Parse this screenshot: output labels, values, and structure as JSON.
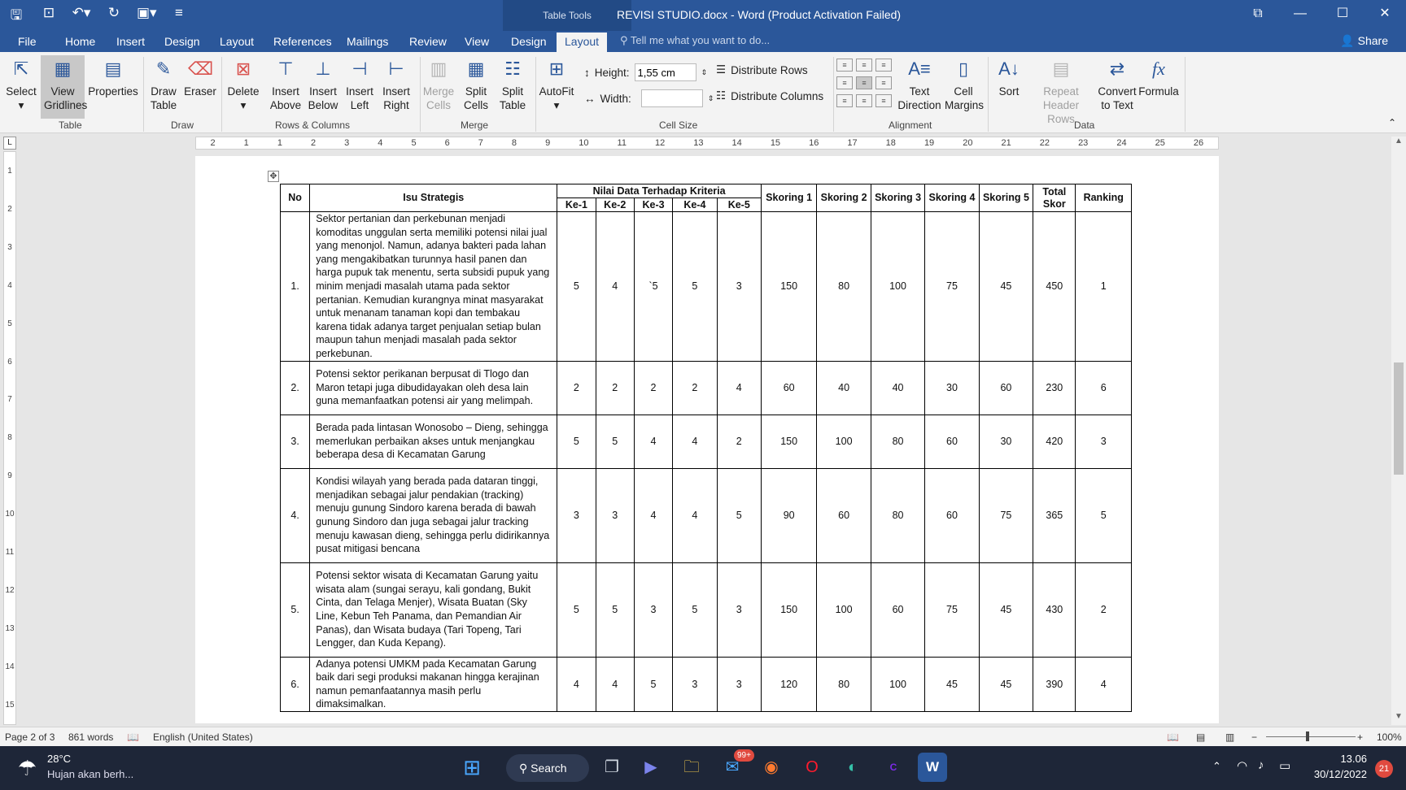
{
  "window": {
    "title": "REVISI STUDIO.docx - Word (Product Activation Failed)",
    "table_tools_label": "Table Tools",
    "controls": [
      "⧉",
      "—",
      "☐",
      "✕"
    ]
  },
  "tabs": {
    "file": "File",
    "home": "Home",
    "insert": "Insert",
    "design": "Design",
    "layout": "Layout",
    "references": "References",
    "mailings": "Mailings",
    "review": "Review",
    "view": "View",
    "table_design": "Design",
    "table_layout": "Layout",
    "tell_me": "Tell me what you want to do...",
    "share": "Share"
  },
  "ribbon": {
    "select": "Select",
    "view_gridlines": "View Gridlines",
    "properties": "Properties",
    "draw_table": "Draw Table",
    "eraser": "Eraser",
    "delete": "Delete",
    "insert_above": "Insert Above",
    "insert_below": "Insert Below",
    "insert_left": "Insert Left",
    "insert_right": "Insert Right",
    "merge_cells": "Merge Cells",
    "split_cells": "Split Cells",
    "split_table": "Split Table",
    "autofit": "AutoFit",
    "height_label": "Height:",
    "height_value": "1,55 cm",
    "width_label": "Width:",
    "width_value": "",
    "distribute_rows": "Distribute Rows",
    "distribute_columns": "Distribute Columns",
    "text_direction": "Text Direction",
    "cell_margins": "Cell Margins",
    "sort": "Sort",
    "repeat_header_rows": "Repeat Header Rows",
    "convert_to_text": "Convert to Text",
    "formula": "Formula",
    "groups": {
      "table": "Table",
      "draw": "Draw",
      "rows_columns": "Rows & Columns",
      "merge": "Merge",
      "cell_size": "Cell Size",
      "alignment": "Alignment",
      "data": "Data"
    }
  },
  "ruler": {
    "horizontal": [
      "2",
      "1",
      "1",
      "2",
      "3",
      "4",
      "5",
      "6",
      "7",
      "8",
      "9",
      "10",
      "11",
      "12",
      "13",
      "14",
      "15",
      "16",
      "17",
      "18",
      "19",
      "20",
      "21",
      "22",
      "23",
      "24",
      "25",
      "26"
    ],
    "vertical": [
      "1",
      "2",
      "3",
      "4",
      "5",
      "6",
      "7",
      "8",
      "9",
      "10",
      "11",
      "12",
      "13",
      "14",
      "15"
    ]
  },
  "table": {
    "headers": {
      "no": "No",
      "isu": "Isu Strategis",
      "nilai": "Nilai Data Terhadap Kriteria",
      "ke": [
        "Ke-1",
        "Ke-2",
        "Ke-3",
        "Ke-4",
        "Ke-5"
      ],
      "skoring": [
        "Skoring 1",
        "Skoring 2",
        "Skoring 3",
        "Skoring 4",
        "Skoring 5"
      ],
      "total": "Total Skor",
      "ranking": "Ranking"
    },
    "rows": [
      {
        "no": "1.",
        "isu": "Sektor pertanian dan perkebunan menjadi komoditas unggulan serta memiliki potensi nilai jual yang menonjol. Namun, adanya bakteri pada lahan yang mengakibatkan turunnya hasil panen dan harga pupuk tak menentu, serta subsidi pupuk yang minim menjadi masalah utama pada sektor pertanian. Kemudian kurangnya minat masyarakat untuk menanam tanaman kopi dan tembakau karena tidak adanya target penjualan setiap bulan maupun tahun menjadi masalah pada sektor perkebunan.",
        "ke1": "5",
        "ke2": "4",
        "ke3": "`5",
        "ke4": "5",
        "ke5": "3",
        "s1": "150",
        "s2": "80",
        "s3": "100",
        "s4": "75",
        "s5": "45",
        "total": "450",
        "rank": "1"
      },
      {
        "no": "2.",
        "isu": "Potensi sektor perikanan berpusat di Tlogo dan Maron tetapi juga dibudidayakan oleh desa lain guna memanfaatkan potensi air yang melimpah.",
        "ke1": "2",
        "ke2": "2",
        "ke3": "2",
        "ke4": "2",
        "ke5": "4",
        "s1": "60",
        "s2": "40",
        "s3": "40",
        "s4": "30",
        "s5": "60",
        "total": "230",
        "rank": "6"
      },
      {
        "no": "3.",
        "isu": "Berada pada lintasan Wonosobo – Dieng, sehingga memerlukan perbaikan akses untuk menjangkau beberapa desa di Kecamatan Garung",
        "ke1": "5",
        "ke2": "5",
        "ke3": "4",
        "ke4": "4",
        "ke5": "2",
        "s1": "150",
        "s2": "100",
        "s3": "80",
        "s4": "60",
        "s5": "30",
        "total": "420",
        "rank": "3"
      },
      {
        "no": "4.",
        "isu": "Kondisi wilayah yang berada pada dataran tinggi, menjadikan sebagai jalur pendakian (tracking) menuju gunung Sindoro karena berada di bawah gunung Sindoro dan juga sebagai jalur tracking menuju kawasan dieng, sehingga perlu didirikannya pusat mitigasi bencana",
        "ke1": "3",
        "ke2": "3",
        "ke3": "4",
        "ke4": "4",
        "ke5": "5",
        "s1": "90",
        "s2": "60",
        "s3": "80",
        "s4": "60",
        "s5": "75",
        "total": "365",
        "rank": "5"
      },
      {
        "no": "5.",
        "isu": "Potensi sektor wisata di Kecamatan Garung yaitu wisata alam (sungai serayu, kali gondang, Bukit Cinta, dan Telaga Menjer), Wisata Buatan (Sky Line, Kebun Teh Panama, dan Pemandian Air Panas), dan Wisata budaya (Tari Topeng, Tari Lengger, dan Kuda Kepang).",
        "ke1": "5",
        "ke2": "5",
        "ke3": "3",
        "ke4": "5",
        "ke5": "3",
        "s1": "150",
        "s2": "100",
        "s3": "60",
        "s4": "75",
        "s5": "45",
        "total": "430",
        "rank": "2"
      },
      {
        "no": "6.",
        "isu": "Adanya potensi UMKM pada Kecamatan Garung baik dari segi produksi makanan hingga kerajinan namun pemanfaatannya masih perlu dimaksimalkan.",
        "ke1": "4",
        "ke2": "4",
        "ke3": "5",
        "ke4": "3",
        "ke5": "3",
        "s1": "120",
        "s2": "80",
        "s3": "100",
        "s4": "45",
        "s5": "45",
        "total": "390",
        "rank": "4"
      }
    ]
  },
  "status": {
    "page": "Page 2 of 3",
    "words": "861 words",
    "language": "English (United States)",
    "zoom": "100%"
  },
  "taskbar": {
    "temp": "28°C",
    "weather": "Hujan akan berh...",
    "search": "Search",
    "mail_badge": "99+",
    "time": "13.06",
    "date": "30/12/2022",
    "notif_badge": "21"
  }
}
